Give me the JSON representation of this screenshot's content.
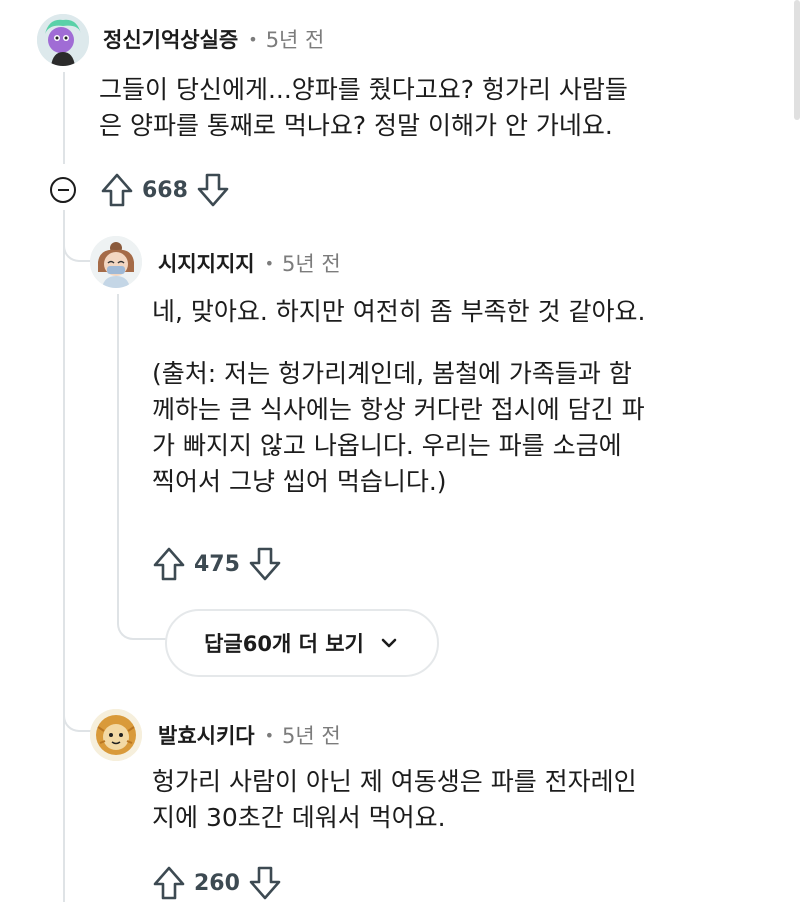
{
  "comments": [
    {
      "username": "정신기억상실증",
      "age": "5년 전",
      "lines": [
        "그들이 당신에게...양파를 줬다고요? 헝가리 사람들",
        "은 양파를 통째로 먹나요? 정말 이해가 안 가네요."
      ],
      "votes": "668"
    },
    {
      "username": "시지지지지",
      "age": "5년 전",
      "lines": [
        "네, 맞아요. 하지만 여전히 좀 부족한 것 같아요."
      ],
      "lines2": [
        "(출처: 저는 헝가리계인데, 봄철에 가족들과 함",
        "께하는 큰 식사에는 항상 커다란 접시에 담긴 파",
        "가 빠지지 않고 나옵니다. 우리는 파를 소금에",
        "찍어서 그냥 씹어 먹습니다.)"
      ],
      "votes": "475",
      "more_replies_label": "답글60개 더 보기"
    },
    {
      "username": "발효시키다",
      "age": "5년 전",
      "lines": [
        "헝가리 사람이 아닌 제 여동생은 파를 전자레인",
        "지에 30초간 데워서 먹어요."
      ],
      "votes": "260"
    }
  ],
  "separator": "•",
  "icons": {
    "upvote": "arrow-up-outline-icon",
    "downvote": "arrow-down-outline-icon",
    "collapse": "collapse-minus-icon",
    "chevron": "chevron-down-icon"
  },
  "colors": {
    "text": "#1c1c1c",
    "meta": "#7c7c7c",
    "thread_line": "#dfe3e6"
  }
}
